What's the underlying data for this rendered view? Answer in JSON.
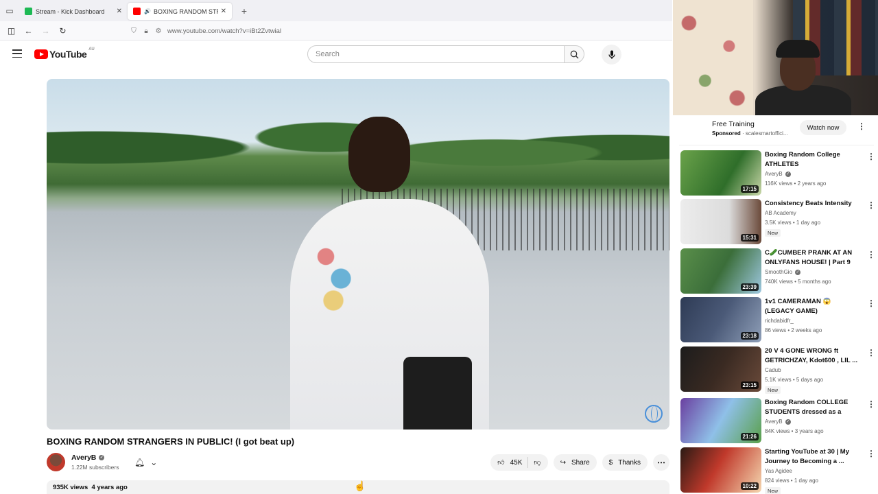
{
  "browser": {
    "tabs": [
      {
        "title": "Stream - Kick Dashboard",
        "favicon_color": "#1db954",
        "active": false
      },
      {
        "title": "BOXING RANDOM STRANG",
        "favicon_color": "#ff0000",
        "active": true
      }
    ],
    "url": "www.youtube.com/watch?v=iBt2Zvtwial"
  },
  "youtube": {
    "logo_text": "YouTube",
    "country": "AU",
    "search_placeholder": "Search"
  },
  "video": {
    "title": "BOXING RANDOM STRANGERS IN PUBLIC! (I got beat up)",
    "channel": "AveryB",
    "subscribers": "1.22M subscribers",
    "likes": "45K",
    "share_label": "Share",
    "thanks_label": "Thanks",
    "views": "935K views",
    "age": "4 years ago"
  },
  "sidebar": {
    "ad": {
      "title": "Free Training",
      "sponsored_label": "Sponsored",
      "advertiser": "scalesmartoffici...",
      "cta": "Watch now"
    },
    "recommendations": [
      {
        "title": "Boxing Random College ATHLETES",
        "channel": "AveryB",
        "verified": true,
        "meta": "116K views • 2 years ago",
        "duration": "17:15",
        "new": false,
        "thumb": "linear-gradient(120deg,#6aa24a,#2f6e2a 60%,#c9d7a8)"
      },
      {
        "title": "Consistency Beats Intensity",
        "channel": "AB Academy",
        "verified": false,
        "meta": "3.5K views • 1 day ago",
        "duration": "15:31",
        "new": true,
        "thumb": "linear-gradient(90deg,#ececec,#dcdcdc 60%,#6b4a3a)"
      },
      {
        "title": "C🥒CUMBER PRANK AT AN ONLYFANS HOUSE! | Part 9",
        "channel": "SmoothGio",
        "verified": true,
        "meta": "740K views • 5 months ago",
        "duration": "23:39",
        "new": false,
        "thumb": "linear-gradient(120deg,#5a8f4a,#3b6e3a 50%,#9ec8e0)"
      },
      {
        "title": "1v1 CAMERAMAN 😱 (LEGACY GAME)",
        "channel": "richdabidfr_",
        "verified": false,
        "meta": "86 views • 2 weeks ago",
        "duration": "23:18",
        "new": false,
        "thumb": "linear-gradient(120deg,#2e3b55,#4b5a78 50%,#8f9fb8)"
      },
      {
        "title": "20 V 4 GONE WRONG ft GETRICHZAY, Kdot600 , LIL ...",
        "channel": "Cadub",
        "verified": false,
        "meta": "5.1K views • 5 days ago",
        "duration": "23:15",
        "new": true,
        "thumb": "linear-gradient(120deg,#1c1c1c,#3a2a22 50%,#6a4a3a)"
      },
      {
        "title": "Boxing Random COLLEGE STUDENTS dressed as a NERD",
        "channel": "AveryB",
        "verified": true,
        "meta": "84K views • 3 years ago",
        "duration": "21:26",
        "new": false,
        "thumb": "linear-gradient(120deg,#6a3fa0,#8fc0e8 50%,#5aa04a)"
      },
      {
        "title": "Starting YouTube at 30 | My Journey to Becoming a ...",
        "channel": "Yas Agidee",
        "verified": false,
        "meta": "824 views • 1 day ago",
        "duration": "10:22",
        "new": true,
        "thumb": "linear-gradient(120deg,#2a1a14,#c0392b 45%,#f5d7b0)"
      }
    ]
  }
}
